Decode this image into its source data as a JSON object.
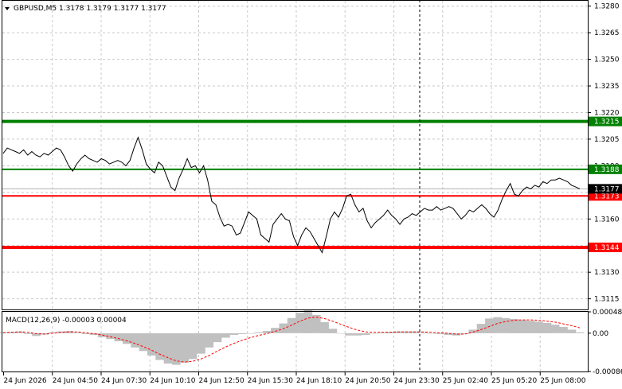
{
  "header": {
    "symbol_line": "GBPUSD,M5  1.3178 1.3179 1.3177 1.3177"
  },
  "macd": {
    "label": "MACD(12,26,9) -0.00003 0.00004",
    "ticks": [
      "0.00048",
      "0.00",
      "-0.00086"
    ]
  },
  "colors": {
    "background": "#ffffff",
    "grid": "#c8c8c8",
    "price_line": "#000000",
    "resistance": "#008000",
    "support": "#ff0000",
    "macd_hist": "#c0c0c0",
    "macd_signal": "#ff0000"
  },
  "chart_data": {
    "type": "line",
    "price_ticks": [
      "1.3280",
      "1.3265",
      "1.3250",
      "1.3235",
      "1.3220",
      "1.3205",
      "1.3190",
      "1.3175",
      "1.3160",
      "1.3145",
      "1.3130",
      "1.3115"
    ],
    "ylim": [
      1.3109,
      1.3283
    ],
    "time_labels": [
      "24 Jun 2026",
      "24 Jun 04:50",
      "24 Jun 07:30",
      "24 Jun 10:10",
      "24 Jun 12:50",
      "24 Jun 15:30",
      "24 Jun 18:10",
      "24 Jun 20:50",
      "24 Jun 23:30",
      "25 Jun 02:40",
      "25 Jun 05:20",
      "25 Jun 08:00"
    ],
    "current_price": "1.3177",
    "levels": [
      {
        "value": 1.3215,
        "label": "1.3215",
        "color": "#008000",
        "style": "thick"
      },
      {
        "value": 1.3188,
        "label": "1.3188",
        "color": "#008000",
        "style": "thin"
      },
      {
        "value": 1.3173,
        "label": "1.3173",
        "color": "#ff0000",
        "style": "thin"
      },
      {
        "value": 1.3144,
        "label": "1.3144",
        "color": "#ff0000",
        "style": "thick"
      }
    ],
    "price_series": [
      1.3197,
      1.32,
      1.3199,
      1.3198,
      1.3197,
      1.3199,
      1.3196,
      1.3198,
      1.3196,
      1.3195,
      1.3197,
      1.3196,
      1.3198,
      1.32,
      1.3199,
      1.3195,
      1.319,
      1.3187,
      1.3191,
      1.3194,
      1.3196,
      1.3194,
      1.3193,
      1.3192,
      1.3194,
      1.3193,
      1.3191,
      1.3192,
      1.3193,
      1.3192,
      1.319,
      1.3193,
      1.32,
      1.3206,
      1.3199,
      1.3191,
      1.3188,
      1.3186,
      1.3192,
      1.319,
      1.3184,
      1.3178,
      1.3176,
      1.3183,
      1.3188,
      1.3194,
      1.3189,
      1.319,
      1.3186,
      1.319,
      1.3182,
      1.317,
      1.3168,
      1.3161,
      1.3156,
      1.3157,
      1.3156,
      1.3151,
      1.3152,
      1.3158,
      1.3164,
      1.3162,
      1.316,
      1.3151,
      1.3149,
      1.3147,
      1.3157,
      1.316,
      1.3163,
      1.316,
      1.3159,
      1.315,
      1.3145,
      1.3151,
      1.3155,
      1.3153,
      1.3149,
      1.3145,
      1.3141,
      1.315,
      1.316,
      1.3164,
      1.3161,
      1.3166,
      1.3173,
      1.3174,
      1.3168,
      1.3164,
      1.3166,
      1.3159,
      1.3155,
      1.3158,
      1.316,
      1.3162,
      1.3165,
      1.3162,
      1.316,
      1.3157,
      1.316,
      1.3161,
      1.3163,
      1.3162,
      1.3164,
      1.3166,
      1.3165,
      1.3165,
      1.3167,
      1.3165,
      1.3166,
      1.3167,
      1.3166,
      1.3163,
      1.316,
      1.3162,
      1.3165,
      1.3164,
      1.3166,
      1.3168,
      1.3166,
      1.3163,
      1.3161,
      1.3165,
      1.3171,
      1.3176,
      1.318,
      1.3174,
      1.3173,
      1.3176,
      1.3178,
      1.3177,
      1.3179,
      1.3178,
      1.3181,
      1.318,
      1.3182,
      1.3182,
      1.3183,
      1.3182,
      1.3181,
      1.3179,
      1.3178,
      1.3177
    ],
    "macd_ylim": [
      -0.00086,
      0.00048
    ],
    "macd_hist": [
      2e-05,
      3e-05,
      4e-05,
      -2e-05,
      -6e-05,
      -3e-05,
      2e-05,
      4e-05,
      5e-05,
      2e-05,
      -2e-05,
      -4e-05,
      -9e-05,
      -0.00013,
      -0.00018,
      -0.00024,
      -0.00032,
      -0.0004,
      -0.0005,
      -0.0006,
      -0.00068,
      -0.00071,
      -0.00066,
      -0.00058,
      -0.00046,
      -0.00032,
      -0.0002,
      -0.0001,
      -4e-05,
      -2e-05,
      -1e-05,
      2e-05,
      5e-05,
      0.00012,
      0.00022,
      0.00034,
      0.00046,
      0.00052,
      0.00041,
      0.00025,
      0.0001,
      0.0,
      -5e-05,
      -5e-05,
      -4e-05,
      0.0,
      2e-05,
      3e-05,
      4e-05,
      4e-05,
      4e-05,
      2e-05,
      0.0,
      -2e-05,
      -4e-05,
      -5e-05,
      -2e-05,
      8e-05,
      0.00021,
      0.00033,
      0.00036,
      0.00034,
      0.00032,
      0.0003,
      0.00028,
      0.00026,
      0.00023,
      0.00019,
      0.00014,
      8e-05,
      2e-05
    ],
    "macd_signal": [
      1e-05,
      2e-05,
      3e-05,
      2e-05,
      -1e-05,
      -2e-05,
      0.0,
      2e-05,
      3e-05,
      3e-05,
      1e-05,
      -1e-05,
      -4e-05,
      -8e-05,
      -0.00012,
      -0.00017,
      -0.00023,
      -0.0003,
      -0.00038,
      -0.00047,
      -0.00055,
      -0.00062,
      -0.00065,
      -0.00063,
      -0.00058,
      -0.0005,
      -0.0004,
      -0.00031,
      -0.00023,
      -0.00016,
      -0.0001,
      -5e-05,
      -1e-05,
      4e-05,
      0.0001,
      0.00018,
      0.00027,
      0.00034,
      0.00036,
      0.00033,
      0.00027,
      0.0002,
      0.00013,
      7e-05,
      3e-05,
      2e-05,
      2e-05,
      2e-05,
      3e-05,
      3e-05,
      3e-05,
      3e-05,
      2e-05,
      1e-05,
      0.0,
      -2e-05,
      -2e-05,
      2e-05,
      8e-05,
      0.00015,
      0.00022,
      0.00026,
      0.00029,
      0.0003,
      0.0003,
      0.00029,
      0.00027,
      0.00025,
      0.00021,
      0.00017,
      0.00012
    ]
  }
}
